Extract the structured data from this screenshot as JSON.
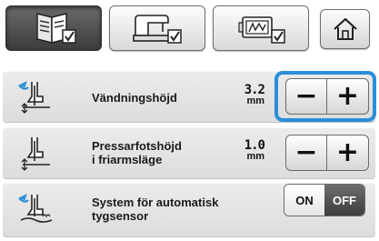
{
  "tabs": [
    {
      "icon": "settings-page-icon",
      "active": true
    },
    {
      "icon": "sewing-machine-settings-icon",
      "active": false
    },
    {
      "icon": "embroidery-settings-icon",
      "active": false
    }
  ],
  "home_icon": "home-icon",
  "settings": [
    {
      "id": "pivot-height",
      "label": "Vändningshöjd",
      "value": "3.2",
      "unit": "mm",
      "control": "stepper",
      "minus_label": "−",
      "plus_label": "+",
      "selected": true
    },
    {
      "id": "free-motion-presser-height",
      "label": "Pressarfotshöjd\ni friarmsläge",
      "value": "1.0",
      "unit": "mm",
      "control": "stepper",
      "minus_label": "−",
      "plus_label": "+",
      "selected": false
    },
    {
      "id": "auto-fabric-sensor",
      "label": "System för automatisk\ntygsensor",
      "control": "toggle",
      "on_label": "ON",
      "off_label": "OFF",
      "state": "off"
    }
  ],
  "colors": {
    "accent_highlight": "#2a8fd8",
    "active_tab": "#4a4a4a"
  }
}
